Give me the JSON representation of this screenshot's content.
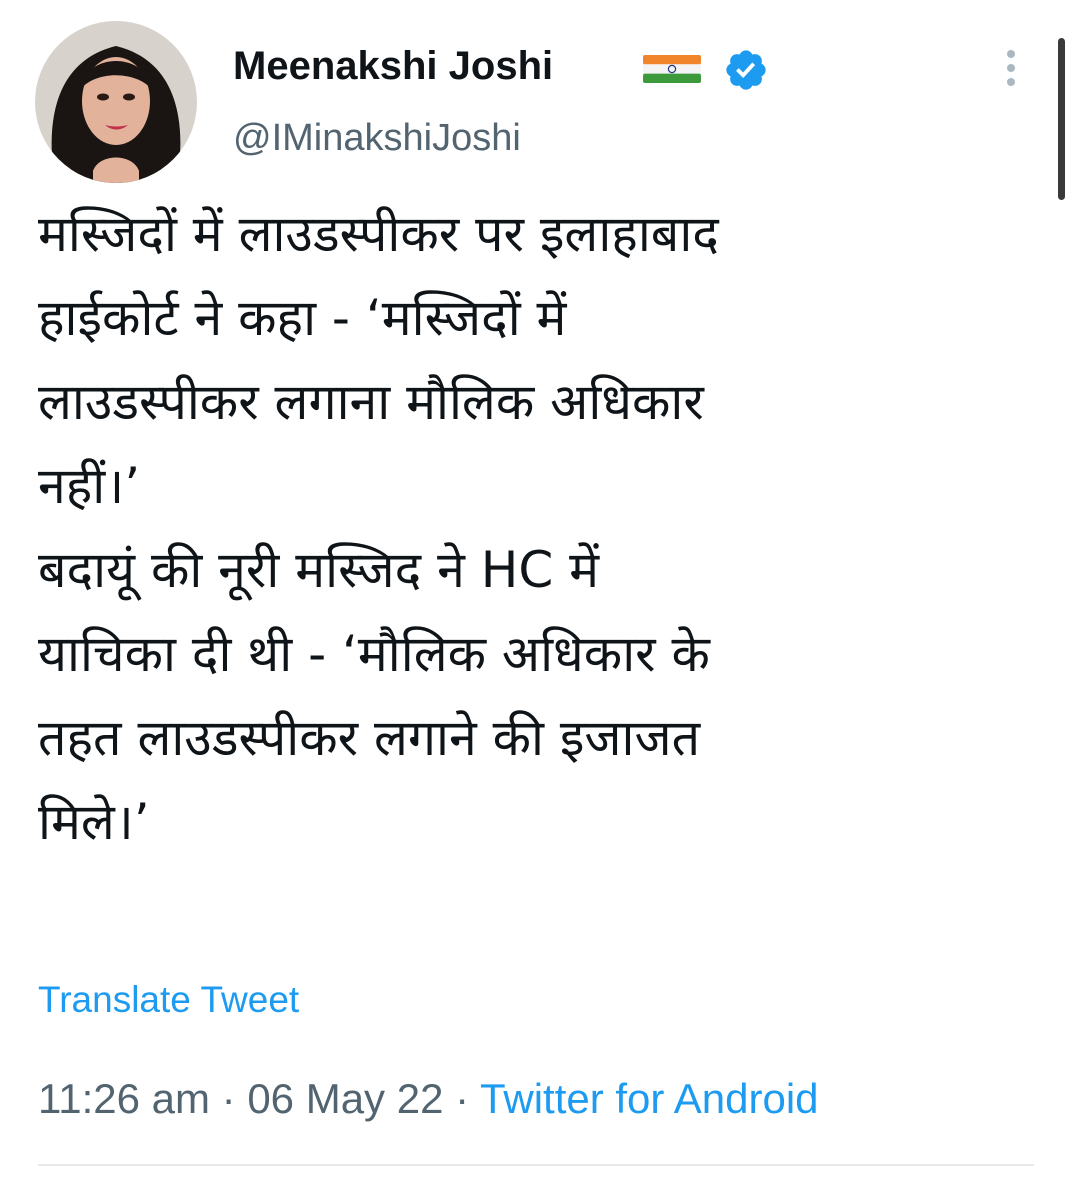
{
  "tweet": {
    "author": {
      "display_name": "Meenakshi Joshi",
      "handle": "@IMinakshiJoshi",
      "avatar": "profile-photo",
      "flag_icon": "india-flag-icon",
      "verified_icon": "verified-badge-icon"
    },
    "text_lines": [
      "मस्जिदों में लाउडस्पीकर पर इलाहाबाद",
      "हाईकोर्ट ने कहा - ‘मस्जिदों में",
      "लाउडस्पीकर लगाना मौलिक अधिकार",
      "नहीं।’",
      "बदायूं की नूरी मस्जिद ने HC में",
      "याचिका दी थी - ‘मौलिक अधिकार के",
      "तहत लाउडस्पीकर लगाने की इजाजत",
      "मिले।’"
    ],
    "translate_label": "Translate Tweet",
    "time": "11:26 am",
    "separator": " · ",
    "date": "06 May 22",
    "source": "Twitter for Android"
  },
  "colors": {
    "text": "#0f1419",
    "secondary": "#536471",
    "accent": "#1d9bf0",
    "divider": "#e7e9ea"
  }
}
